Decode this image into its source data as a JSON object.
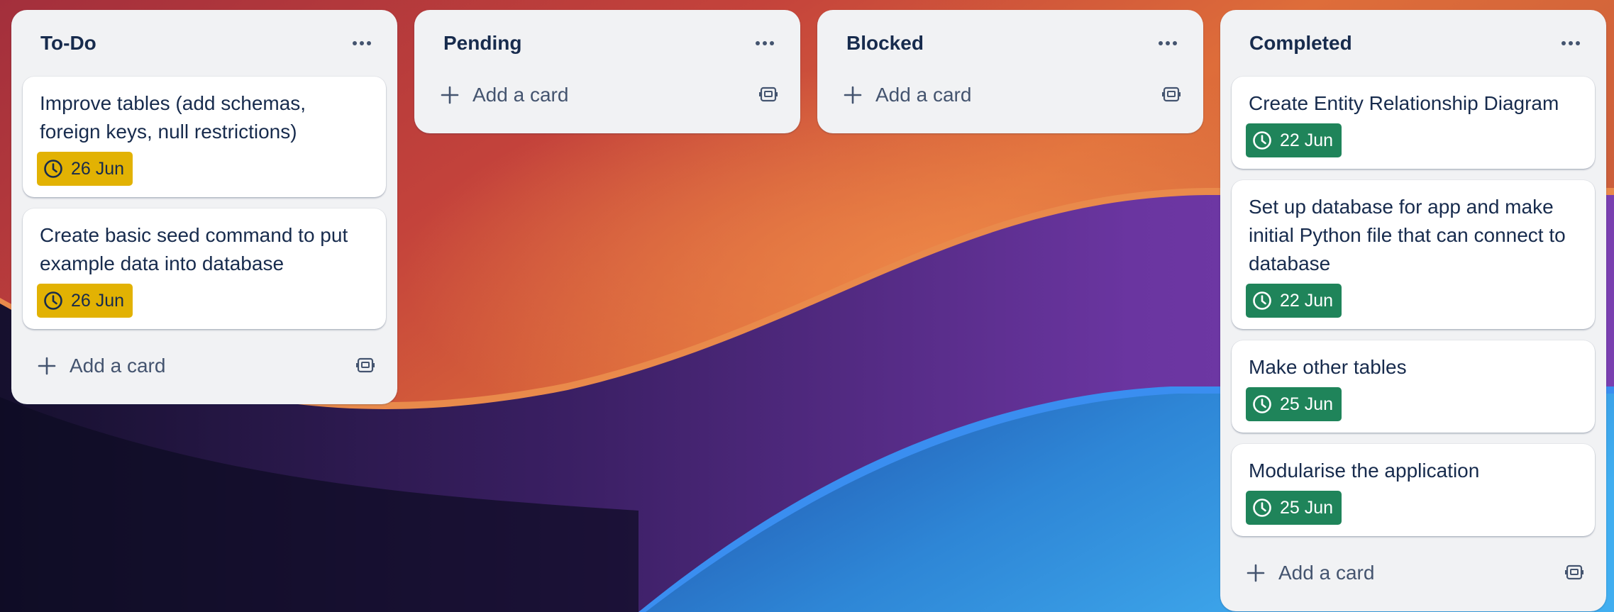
{
  "lists": [
    {
      "title": "To-Do",
      "cards": [
        {
          "title": "Improve tables (add schemas, foreign keys, null restrictions)",
          "due": "26 Jun",
          "due_color": "#e2b203"
        },
        {
          "title": "Create basic seed command to put example data into database",
          "due": "26 Jun",
          "due_color": "#e2b203"
        }
      ],
      "add_label": "Add a card"
    },
    {
      "title": "Pending",
      "cards": [],
      "add_label": "Add a card"
    },
    {
      "title": "Blocked",
      "cards": [],
      "add_label": "Add a card"
    },
    {
      "title": "Completed",
      "cards": [
        {
          "title": "Create Entity Relationship Diagram",
          "due": "22 Jun",
          "due_color": "#1f845a"
        },
        {
          "title": "Set up database for app and make initial Python file that can connect to database",
          "due": "22 Jun",
          "due_color": "#1f845a"
        },
        {
          "title": "Make other tables",
          "due": "25 Jun",
          "due_color": "#1f845a"
        },
        {
          "title": "Modularise the application",
          "due": "25 Jun",
          "due_color": "#1f845a"
        }
      ],
      "add_label": "Add a card"
    }
  ],
  "icons": {
    "list_menu": "ellipsis-icon",
    "due_date": "clock-icon",
    "add_card": "plus-icon",
    "create_from_template": "template-icon"
  },
  "colors": {
    "list_background": "#f1f2f4",
    "card_background": "#ffffff",
    "text": "#172b4d",
    "muted_text": "#44546f",
    "due_soon": "#e2b203",
    "due_complete": "#1f845a"
  }
}
